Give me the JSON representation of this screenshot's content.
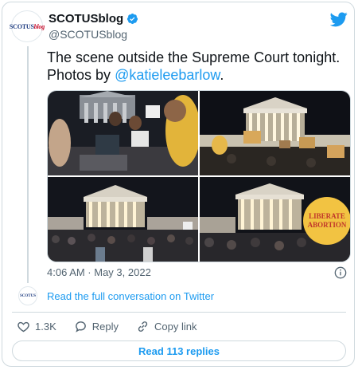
{
  "account": {
    "name": "SCOTUSblog",
    "handle": "@SCOTUSblog",
    "avatar_text_prefix": "SCOTUS",
    "avatar_text_suffix": "blog"
  },
  "tweet": {
    "text_before": "The scene outside the Supreme Court tonight.",
    "text_photos": "Photos by ",
    "mention": "@katieleebarlow",
    "text_end": ".",
    "timestamp": "4:06 AM · May 3, 2022"
  },
  "photos": [
    {
      "alt": "crowd-at-steps"
    },
    {
      "alt": "court-with-signs"
    },
    {
      "alt": "court-crowd-night"
    },
    {
      "alt": "court-liberate-abortion-sign"
    }
  ],
  "sign_text": [
    "LIBERATE",
    "ABORTION"
  ],
  "read_conversation": "Read the full conversation on Twitter",
  "actions": {
    "likes": "1.3K",
    "reply": "Reply",
    "copy_link": "Copy link"
  },
  "replies_button": "Read 113 replies",
  "colors": {
    "accent": "#1d9bf0",
    "like_red": "#f91880",
    "text_secondary": "#536471"
  }
}
